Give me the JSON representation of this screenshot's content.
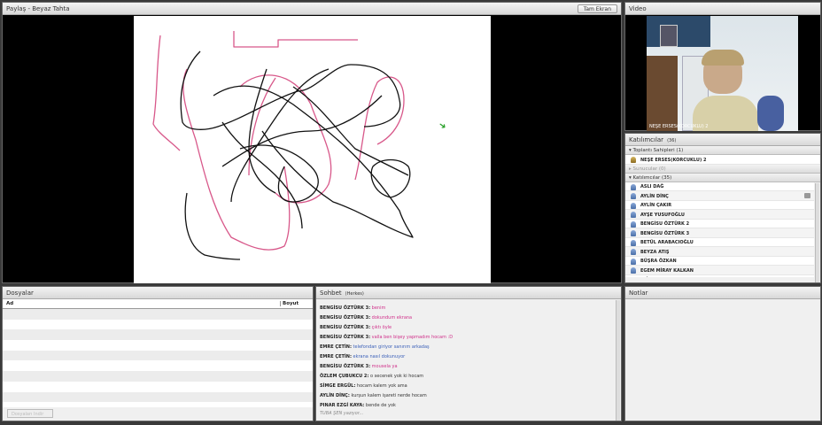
{
  "share": {
    "title": "Paylaş - Beyaz Tahta",
    "fullscreen": "Tam Ekran"
  },
  "video": {
    "title": "Video",
    "name": "NEŞE ERSES(KORCUKLU) 2"
  },
  "attendees": {
    "title": "Katılımcılar",
    "count": "(36)",
    "hosts": "Toplantı Sahipleri (1)",
    "host_name": "NEŞE ERSES(KORCUKLU) 2",
    "presenters": "Sunucular (0)",
    "participants": "Katılımcılar (35)",
    "list": [
      "ASLI DAĞ",
      "AYLİN DİNÇ",
      "AYLİN ÇAKIR",
      "AYŞE YUSUFOĞLU",
      "BENGİSU ÖZTÜRK 2",
      "BENGİSU ÖZTÜRK 3",
      "BETÜL ARABACIOĞLU",
      "BEYZA ATIŞ",
      "BÜŞRA ÖZKAN",
      "EGEM MİRAY KALKAN",
      "ELİF ARI"
    ]
  },
  "files": {
    "title": "Dosyalar",
    "col_name": "Ad",
    "col_size": "Boyut",
    "upload": "Dosyaları Indir"
  },
  "chat": {
    "title": "Sohbet",
    "scope": "(Herkes)",
    "messages": [
      {
        "from": "BENGİSU ÖZTÜRK 3:",
        "text": "benim",
        "color": "#d0308a"
      },
      {
        "from": "BENGİSU ÖZTÜRK 3:",
        "text": "dokundum ekrana",
        "color": "#d0308a"
      },
      {
        "from": "BENGİSU ÖZTÜRK 3:",
        "text": "çıktı öyle",
        "color": "#d0308a"
      },
      {
        "from": "BENGİSU ÖZTÜRK 3:",
        "text": "valla ben bişey yapmadım hocam :D",
        "color": "#d0308a"
      },
      {
        "from": "EMRE ÇETİN:",
        "text": "telefondan giriyor sanırım arkadaş",
        "color": "#3a5fb8"
      },
      {
        "from": "EMRE ÇETİN:",
        "text": "ekrana nasıl dokunuyor",
        "color": "#3a5fb8"
      },
      {
        "from": "BENGİSU ÖZTÜRK 3:",
        "text": "mousela ya",
        "color": "#d0308a"
      },
      {
        "from": "ÖZLEM ÇUBUKCU 2:",
        "text": "o secenek yok ki hocam",
        "color": "#333333"
      },
      {
        "from": "SİMGE ERGÜL:",
        "text": "hocam kalem yok ama",
        "color": "#333333"
      },
      {
        "from": "AYLİN DİNÇ:",
        "text": "kurşun kalem işareti nerde hocam",
        "color": "#333333"
      },
      {
        "from": "PINAR EZGİ KAYA:",
        "text": "bende de yok",
        "color": "#333333"
      }
    ],
    "typing": "TUBA ŞEN yazıyor..."
  },
  "notes": {
    "title": "Notlar"
  }
}
